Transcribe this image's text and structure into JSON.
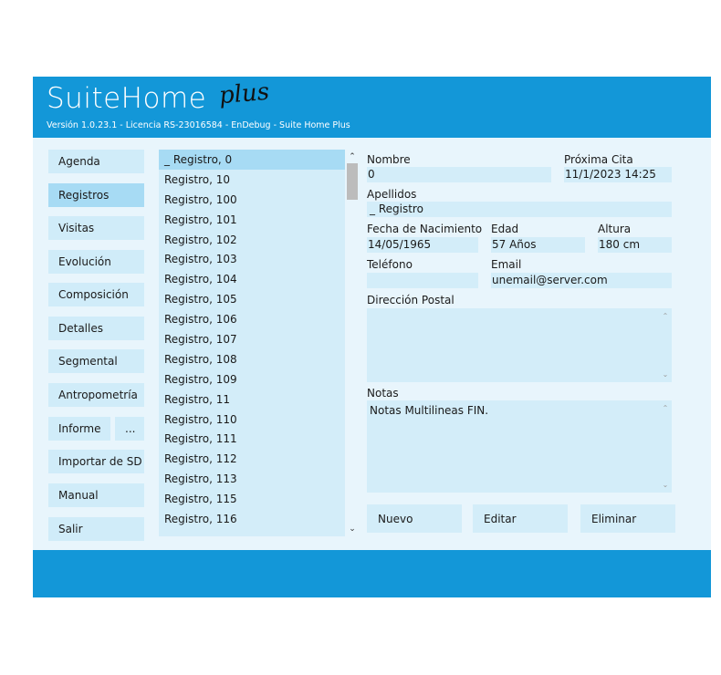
{
  "header": {
    "title": "SuiteHome",
    "title_plus": "plus",
    "subtitle": "Versión 1.0.23.1 - Licencia RS-23016584 - EnDebug - Suite Home Plus"
  },
  "nav": {
    "agenda": "Agenda",
    "registros": "Registros",
    "visitas": "Visitas",
    "evolucion": "Evolución",
    "composicion": "Composición",
    "detalles": "Detalles",
    "segmental": "Segmental",
    "antropometria": "Antropometría",
    "informe": "Informe",
    "informe_more": "...",
    "importar": "Importar de SD",
    "manual": "Manual",
    "salir": "Salir"
  },
  "records": [
    "_ Registro, 0",
    "Registro, 10",
    "Registro, 100",
    "Registro, 101",
    "Registro, 102",
    "Registro, 103",
    "Registro, 104",
    "Registro, 105",
    "Registro, 106",
    "Registro, 107",
    "Registro, 108",
    "Registro, 109",
    "Registro, 11",
    "Registro, 110",
    "Registro, 111",
    "Registro, 112",
    "Registro, 113",
    "Registro, 115",
    "Registro, 116"
  ],
  "list_scroll": {
    "up": "⌃",
    "down": "⌄"
  },
  "form": {
    "nombre_label": "Nombre",
    "nombre_value": "0",
    "proxima_label": "Próxima Cita",
    "proxima_value": "11/1/2023 14:25",
    "apellidos_label": "Apellidos",
    "apellidos_value": "_ Registro",
    "nacimiento_label": "Fecha de Nacimiento",
    "nacimiento_value": "14/05/1965",
    "edad_label": "Edad",
    "edad_value": "57 Años",
    "altura_label": "Altura",
    "altura_value": "180 cm",
    "telefono_label": "Teléfono",
    "telefono_value": "",
    "email_label": "Email",
    "email_value": "unemail@server.com",
    "direccion_label": "Dirección Postal",
    "direccion_value": "",
    "notas_label": "Notas",
    "notas_value": "Notas Multilineas FIN."
  },
  "actions": {
    "nuevo": "Nuevo",
    "editar": "Editar",
    "eliminar": "Eliminar"
  }
}
